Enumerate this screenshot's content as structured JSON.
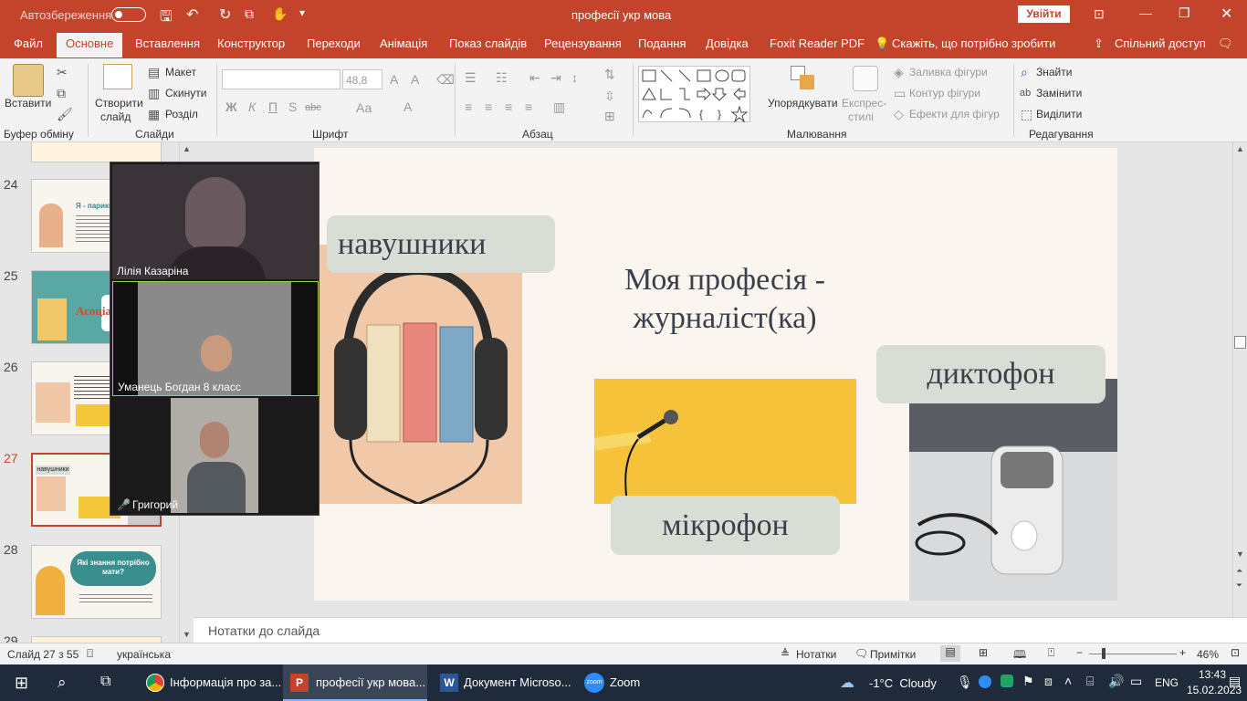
{
  "titlebar": {
    "autosave": "Автозбереження",
    "doc_title": "професії укр мова",
    "signin": "Увійти"
  },
  "tabs": [
    {
      "label": "Файл"
    },
    {
      "label": "Основне"
    },
    {
      "label": "Вставлення"
    },
    {
      "label": "Конструктор"
    },
    {
      "label": "Переходи"
    },
    {
      "label": "Анімація"
    },
    {
      "label": "Показ слайдів"
    },
    {
      "label": "Рецензування"
    },
    {
      "label": "Подання"
    },
    {
      "label": "Довідка"
    },
    {
      "label": "Foxit Reader PDF"
    }
  ],
  "tell_me": "Скажіть, що потрібно зробити",
  "share": "Спільний доступ",
  "ribbon": {
    "paste": "Вставити",
    "new_slide": "Створити",
    "new_slide2": "слайд",
    "layout": "Макет",
    "reset": "Скинути",
    "section": "Розділ",
    "font_name": "",
    "font_size": "48,8",
    "arrange": "Упорядкувати",
    "quick_styles": "Експрес-",
    "quick_styles2": "стилі",
    "shape_fill": "Заливка фігури",
    "shape_outline": "Контур фігури",
    "shape_effects": "Ефекти для фігур",
    "find": "Знайти",
    "replace": "Замінити",
    "select": "Виділити",
    "groups": {
      "clipboard": "Буфер обміну",
      "slides": "Слайди",
      "font": "Шрифт",
      "paragraph": "Абзац",
      "drawing": "Малювання",
      "editing": "Редагування"
    },
    "font_btns": [
      "Ж",
      "К",
      "П",
      "S",
      "abc",
      "Аа"
    ]
  },
  "thumbnails": [
    {
      "num": "24",
      "title": "Я - парикмахер"
    },
    {
      "num": "25",
      "title": "Асоціа"
    },
    {
      "num": "26",
      "title": ""
    },
    {
      "num": "27",
      "title": "навушники"
    },
    {
      "num": "28",
      "title": "Які знання потрібно мати?"
    },
    {
      "num": "29",
      "title": ""
    }
  ],
  "slide": {
    "title": "Моя професія - журналіст(ка)",
    "label_headphones": "навушники",
    "label_recorder": "диктофон",
    "label_microphone": "мікрофон"
  },
  "zoom": {
    "participants": [
      {
        "name": "Лілія Казаріна"
      },
      {
        "name": "Уманець Богдан 8 класс"
      },
      {
        "name": "Григорий"
      }
    ]
  },
  "notes_placeholder": "Нотатки до слайда",
  "status": {
    "slide_info": "Слайд 27 з 55",
    "language": "українська",
    "notes": "Нотатки",
    "comments": "Примітки",
    "zoom": "46%"
  },
  "taskbar": {
    "apps": [
      {
        "label": "Інформація про за..."
      },
      {
        "label": "професії укр мова..."
      },
      {
        "label": "Документ Microso..."
      },
      {
        "label": "Zoom"
      }
    ],
    "weather": "-1°C  Cloudy",
    "lang": "ENG",
    "time": "13:43",
    "date": "15.02.2023"
  },
  "colors": {
    "accent": "#c4432b",
    "slide_bg": "#faf6ef",
    "pill": "#d8ded6",
    "taskbar": "#1f2a3a"
  }
}
